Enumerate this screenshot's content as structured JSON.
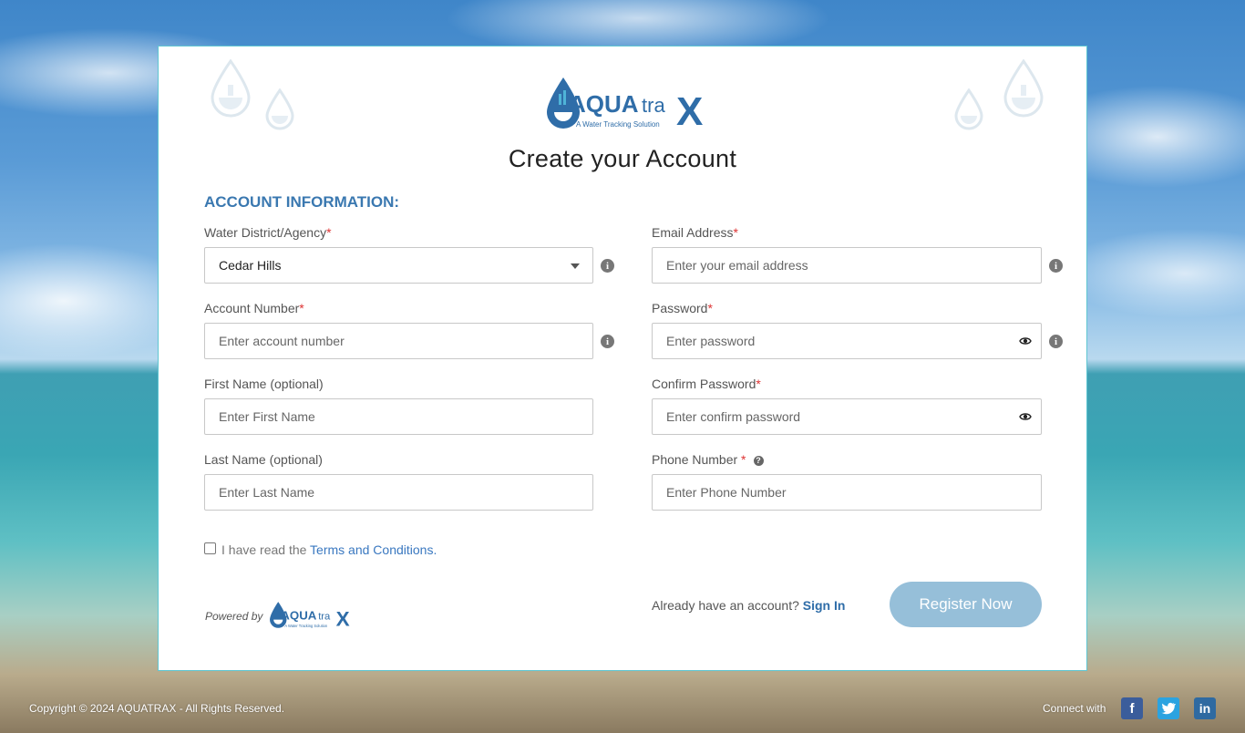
{
  "brand": {
    "name": "AQUATRAX",
    "tagline": "A Water Tracking Solution",
    "logo_main": "AQUA",
    "logo_tra": "tra",
    "logo_x": "X"
  },
  "page": {
    "title": "Create your Account",
    "section_heading": "ACCOUNT INFORMATION:"
  },
  "colors": {
    "accent": "#3a78b0",
    "link": "#3a78c0",
    "button": "#96bfd9",
    "required": "#d33333"
  },
  "form": {
    "water_district": {
      "label": "Water District/Agency",
      "required_mark": "*",
      "value": "Cedar Hills"
    },
    "account_number": {
      "label": "Account Number",
      "required_mark": "*",
      "placeholder": "Enter account number"
    },
    "first_name": {
      "label": "First Name (optional)",
      "placeholder": "Enter First Name"
    },
    "last_name": {
      "label": "Last Name (optional)",
      "placeholder": "Enter Last Name"
    },
    "email": {
      "label": "Email Address",
      "required_mark": "*",
      "placeholder": "Enter your email address"
    },
    "password": {
      "label": "Password",
      "required_mark": "*",
      "placeholder": "Enter password"
    },
    "confirm_password": {
      "label": "Confirm Password",
      "required_mark": "*",
      "placeholder": "Enter confirm password"
    },
    "phone": {
      "label": "Phone Number",
      "required_mark": " *",
      "placeholder": "Enter Phone Number"
    },
    "terms": {
      "prefix": "I have read the ",
      "link": "Terms and Conditions.",
      "checked": false
    }
  },
  "footer_actions": {
    "powered_by": "Powered by",
    "already": "Already have an account? ",
    "sign_in": "Sign In",
    "register": "Register Now"
  },
  "footer": {
    "copyright": "Copyright © 2024 AQUATRAX - All Rights Reserved.",
    "connect": "Connect with",
    "social": [
      "facebook-icon",
      "twitter-icon",
      "linkedin-icon"
    ]
  }
}
